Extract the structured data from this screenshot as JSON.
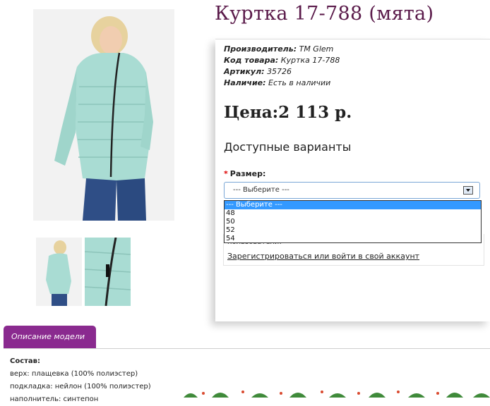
{
  "product": {
    "title": "Куртка 17-788 (мята)",
    "manufacturer_label": "Производитель:",
    "manufacturer_value": "TM Glem",
    "code_label": "Код товара:",
    "code_value": "Куртка 17-788",
    "article_label": "Артикул:",
    "article_value": "35726",
    "availability_label": "Наличие:",
    "availability_value": "Есть в наличии",
    "price": "Цена:2 113 р."
  },
  "options": {
    "heading": "Доступные варианты",
    "size_label": "Размер:",
    "size_selected": "--- Выберите ---",
    "size_options": [
      "--- Выберите ---",
      "48",
      "50",
      "52",
      "54"
    ]
  },
  "login": {
    "note": "пользователи!",
    "link": "Зарегистрироваться или войти в свой аккаунт"
  },
  "description": {
    "tab_label": "Описание модели",
    "heading": "Состав:",
    "lines": [
      "верх: плащевка (100% полиэстер)",
      "подкладка: нейлон (100% полиэстер)",
      "наполнитель: синтепон"
    ]
  },
  "colors": {
    "title": "#5a1a4a",
    "tab": "#8a2a8f",
    "jacket": "#a9dcd3",
    "selected_option": "#3399ff"
  }
}
